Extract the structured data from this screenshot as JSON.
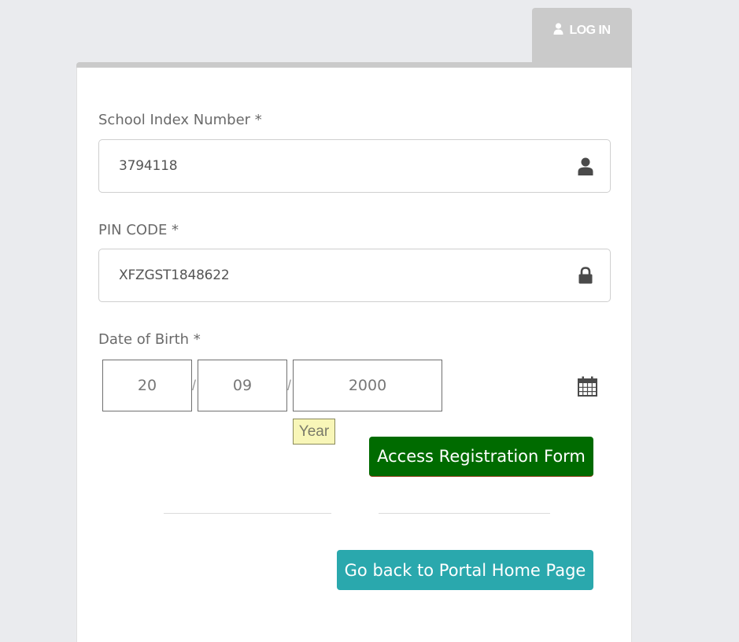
{
  "tab": {
    "label": "LOG IN",
    "icon": "user-icon"
  },
  "form": {
    "school_index": {
      "label": "School Index Number *",
      "value": "3794118",
      "icon": "user-icon"
    },
    "pin_code": {
      "label": "PIN CODE *",
      "value": "XFZGST1848622",
      "icon": "lock-icon"
    },
    "dob": {
      "label": "Date of Birth *",
      "day": "20",
      "month": "09",
      "year": "2000",
      "separator": "/",
      "tooltip": "Year",
      "icon": "calendar-icon"
    }
  },
  "buttons": {
    "access": "Access Registration Form",
    "home": "Go back to Portal Home Page"
  },
  "colors": {
    "access_button": "#006b00",
    "home_button": "#2aa8ad",
    "tab": "#cacaca"
  }
}
